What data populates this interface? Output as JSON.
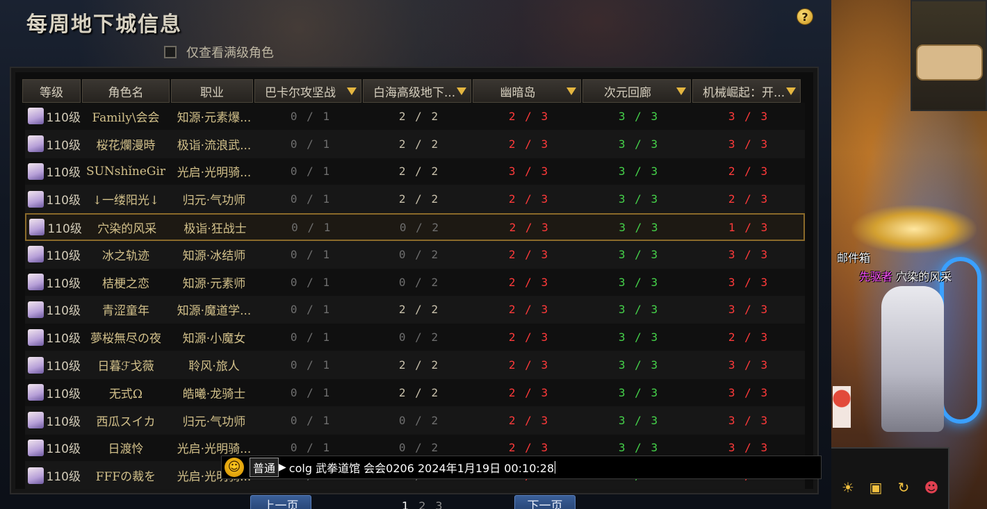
{
  "window": {
    "title": "每周地下城信息",
    "help_icon": "?",
    "filter_label": "仅查看满级角色",
    "filter_checked": false
  },
  "columns": {
    "level": "等级",
    "name": "角色名",
    "job": "职业",
    "d1": "巴卡尔攻坚战",
    "d2": "白海高级地下...",
    "d3": "幽暗岛",
    "d4": "次元回廊",
    "d5": "机械崛起：开..."
  },
  "rows": [
    {
      "level": "110级",
      "name": "Family\\会会",
      "job": "知源·元素爆...",
      "d1": "0 / 1",
      "d2": "2 / 2",
      "d3": "2 / 3",
      "d4": "3 / 3",
      "d5": "3 / 3"
    },
    {
      "level": "110级",
      "name": "桜花爛漫時",
      "job": "极诣·流浪武...",
      "d1": "0 / 1",
      "d2": "2 / 2",
      "d3": "2 / 3",
      "d4": "3 / 3",
      "d5": "3 / 3"
    },
    {
      "level": "110级",
      "name": "SUNshǐneGir",
      "job": "光启·光明骑...",
      "d1": "0 / 1",
      "d2": "2 / 2",
      "d3": "3 / 3",
      "d4": "3 / 3",
      "d5": "2 / 3"
    },
    {
      "level": "110级",
      "name": "↓一缕阳光↓",
      "job": "归元·气功师",
      "d1": "0 / 1",
      "d2": "2 / 2",
      "d3": "2 / 3",
      "d4": "3 / 3",
      "d5": "2 / 3"
    },
    {
      "level": "110级",
      "name": "穴染的风采",
      "job": "极诣·狂战士",
      "d1": "0 / 1",
      "d2": "0 / 2",
      "d3": "2 / 3",
      "d4": "3 / 3",
      "d5": "1 / 3",
      "selected": true
    },
    {
      "level": "110级",
      "name": "冰之轨迹",
      "job": "知源·冰结师",
      "d1": "0 / 1",
      "d2": "0 / 2",
      "d3": "2 / 3",
      "d4": "3 / 3",
      "d5": "3 / 3"
    },
    {
      "level": "110级",
      "name": "桔梗之恋",
      "job": "知源·元素师",
      "d1": "0 / 1",
      "d2": "0 / 2",
      "d3": "2 / 3",
      "d4": "3 / 3",
      "d5": "3 / 3"
    },
    {
      "level": "110级",
      "name": "青涩童年",
      "job": "知源·魔道学...",
      "d1": "0 / 1",
      "d2": "2 / 2",
      "d3": "2 / 3",
      "d4": "3 / 3",
      "d5": "3 / 3"
    },
    {
      "level": "110级",
      "name": "夢桜無尽の夜",
      "job": "知源·小魔女",
      "d1": "0 / 1",
      "d2": "0 / 2",
      "d3": "2 / 3",
      "d4": "3 / 3",
      "d5": "2 / 3"
    },
    {
      "level": "110级",
      "name": "日暮ℱ戈薇",
      "job": "聆风·旅人",
      "d1": "0 / 1",
      "d2": "2 / 2",
      "d3": "2 / 3",
      "d4": "3 / 3",
      "d5": "3 / 3"
    },
    {
      "level": "110级",
      "name": "无式Ω",
      "job": "皓曦·龙骑士",
      "d1": "0 / 1",
      "d2": "2 / 2",
      "d3": "2 / 3",
      "d4": "3 / 3",
      "d5": "3 / 3"
    },
    {
      "level": "110级",
      "name": "西瓜スイカ",
      "job": "归元·气功师",
      "d1": "0 / 1",
      "d2": "0 / 2",
      "d3": "2 / 3",
      "d4": "3 / 3",
      "d5": "3 / 3"
    },
    {
      "level": "110级",
      "name": "日渡怜",
      "job": "光启·光明骑...",
      "d1": "0 / 1",
      "d2": "0 / 2",
      "d3": "2 / 3",
      "d4": "3 / 3",
      "d5": "3 / 3"
    },
    {
      "level": "110级",
      "name": "FFFの裁を",
      "job": "光启·光明骑...",
      "d1": "0 / 1",
      "d2": "0 / 2",
      "d3": "2 / 3",
      "d4": "3 / 3",
      "d5": "3 / 3"
    }
  ],
  "chat": {
    "channel": "普通",
    "text": "colg  武拳道馆 会会0206 2024年1月19日 00:10:28"
  },
  "pager": {
    "prev": "上一页",
    "next": "下一页",
    "pages": [
      "1",
      "2",
      "3"
    ],
    "current": "1"
  },
  "game": {
    "npc_label": "邮件箱",
    "player_title": "先驱者",
    "player_name": "穴染的风采"
  },
  "colors": {
    "complete_red": "#ff3a3a",
    "remaining_green": "#45d24a",
    "empty_gray": "#6e6e6e",
    "accent_gold": "#e4b640"
  }
}
